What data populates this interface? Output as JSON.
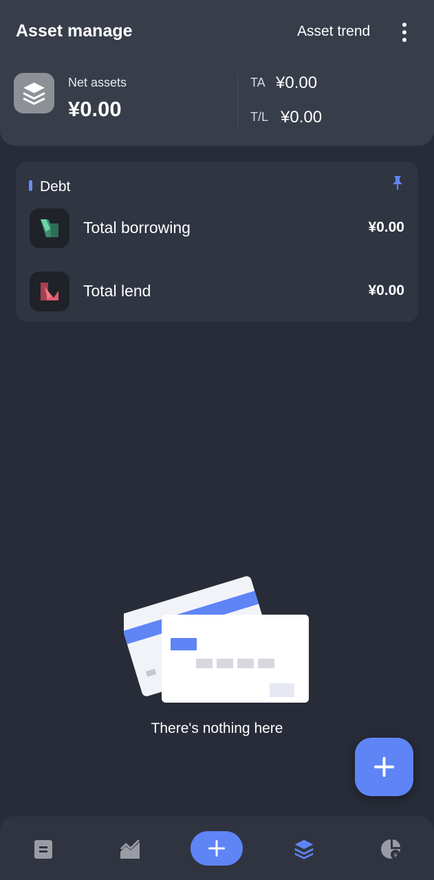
{
  "header": {
    "title": "Asset manage",
    "trend_label": "Asset trend",
    "more_icon": "more-vertical-icon"
  },
  "summary": {
    "net_assets_label": "Net assets",
    "net_assets_value": "¥0.00",
    "ta_label": "TA",
    "ta_value": "¥0.00",
    "tl_label": "T/L",
    "tl_value": "¥0.00",
    "icon": "layers-icon"
  },
  "debt": {
    "title": "Debt",
    "pin_icon": "pin-icon",
    "items": [
      {
        "label": "Total borrowing",
        "value": "¥0.00",
        "icon": "borrow-icon"
      },
      {
        "label": "Total lend",
        "value": "¥0.00",
        "icon": "lend-icon"
      }
    ]
  },
  "empty_state": {
    "message": "There's nothing here",
    "illustration": "cards-illustration"
  },
  "fab": {
    "icon": "plus-icon"
  },
  "bottom_nav": {
    "items": [
      "ledger-icon",
      "trend-icon",
      "add-icon",
      "assets-icon",
      "budget-icon"
    ],
    "active": "assets-icon"
  },
  "colors": {
    "background": "#272c38",
    "header": "#383d4a",
    "card": "#303542",
    "accent": "#5f84f6",
    "borrow": "#4faf8a",
    "lend": "#e15a6c"
  }
}
